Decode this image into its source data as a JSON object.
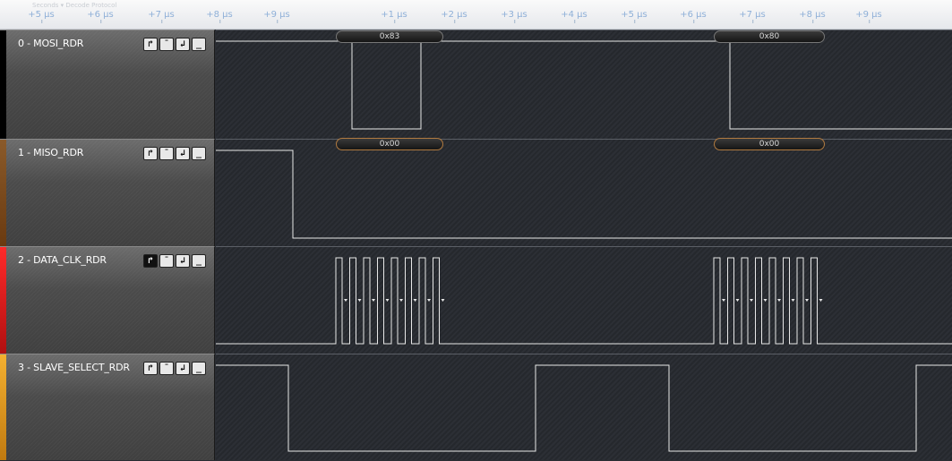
{
  "ruler": {
    "ticks": [
      "+5 µs",
      "+6 µs",
      "+7 µs",
      "+8 µs",
      "+9 µs",
      "+1 µs",
      "+2 µs",
      "+3 µs",
      "+4 µs",
      "+5 µs",
      "+6 µs",
      "+7 µs",
      "+8 µs",
      "+9 µs"
    ],
    "faint_label": "Seconds  ▾  Decode Protocol"
  },
  "channels": [
    {
      "name": "0 - MOSI_RDR",
      "color": "#000000",
      "decoded": [
        "0x83",
        "0x80"
      ]
    },
    {
      "name": "1 - MISO_RDR",
      "color": "#7a4513",
      "decoded": [
        "0x00",
        "0x00"
      ]
    },
    {
      "name": "2 - DATA_CLK_RDR",
      "color": "#e01b1b",
      "decoded": []
    },
    {
      "name": "3 - SLAVE_SELECT_RDR",
      "color": "#f0a020",
      "decoded": []
    }
  ],
  "trigger_buttons": {
    "rising": "↱",
    "high": "¯",
    "falling": "↲",
    "low": "_"
  },
  "icons": [
    "rising-edge-icon",
    "high-level-icon",
    "falling-edge-icon",
    "low-level-icon"
  ]
}
